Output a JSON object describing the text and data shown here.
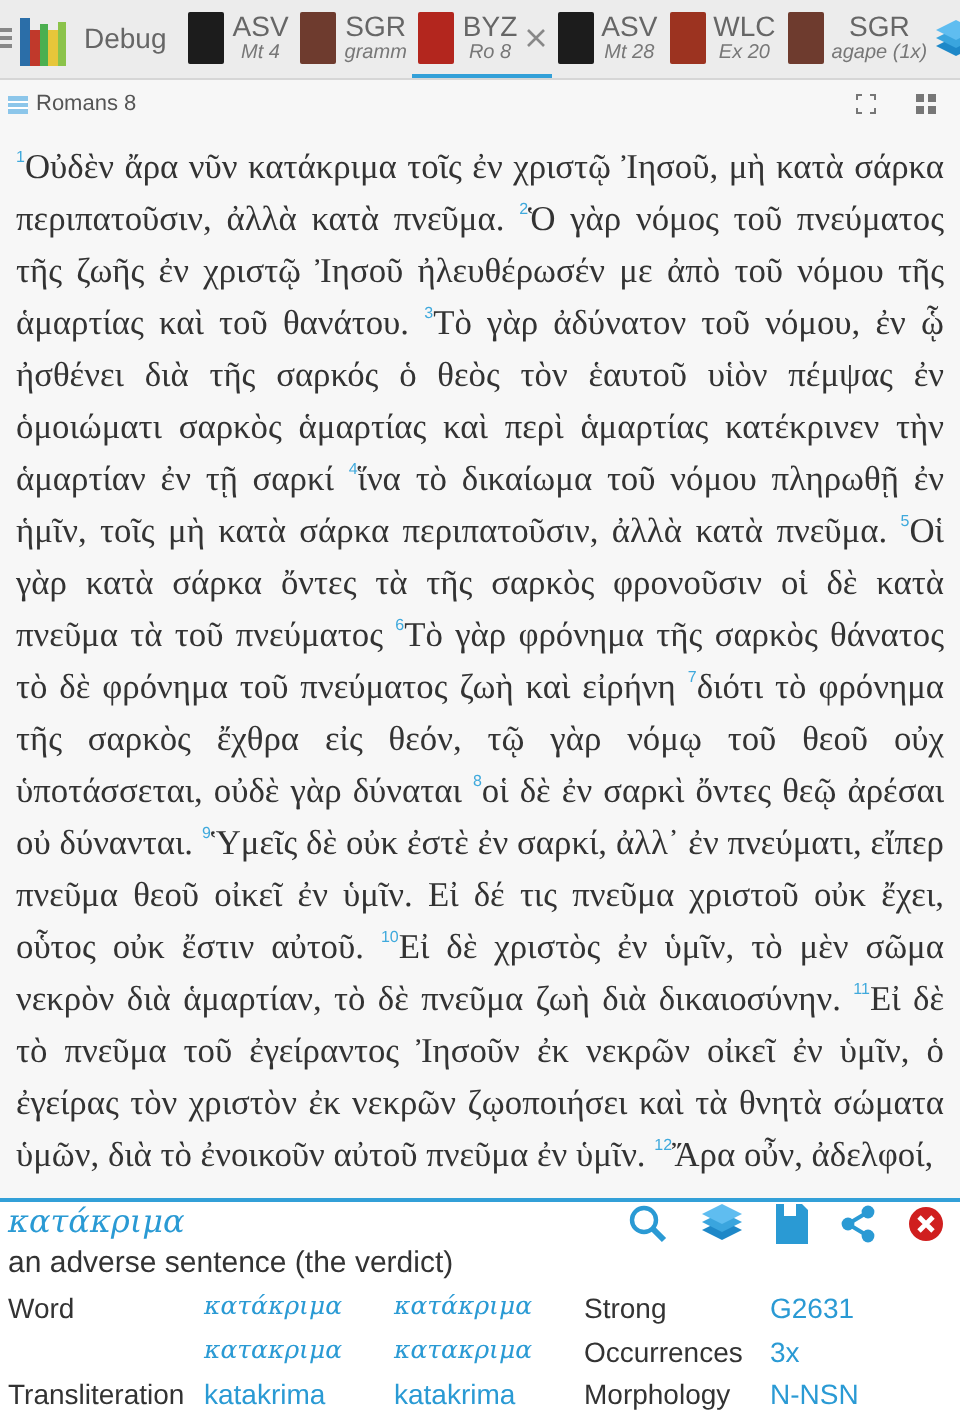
{
  "toolbar": {
    "app_label": "Debug",
    "tabs": [
      {
        "name": "ASV",
        "subtitle": "Mt 4",
        "color": "#1c1c1c",
        "selected": false,
        "closable": false
      },
      {
        "name": "SGR",
        "subtitle": "gramm",
        "color": "#6e3b2e",
        "selected": false,
        "closable": false
      },
      {
        "name": "BYZ",
        "subtitle": "Ro 8",
        "color": "#b3261e",
        "selected": true,
        "closable": true
      },
      {
        "name": "ASV",
        "subtitle": "Mt 28",
        "color": "#1c1c1c",
        "selected": false,
        "closable": false
      },
      {
        "name": "WLC",
        "subtitle": "Ex 20",
        "color": "#9c3320",
        "selected": false,
        "closable": false
      },
      {
        "name": "SGR",
        "subtitle": "agape (1x)",
        "color": "#6e3b2e",
        "selected": false,
        "closable": false
      }
    ]
  },
  "header": {
    "title": "Romans 8"
  },
  "passage": {
    "text": "$^{1}$Οὐδὲν ἄρα νῦν κατάκριμα τοῖς ἐν χριστῷ Ἰησοῦ, μὴ κατὰ σάρκα περιπατοῦσιν, ἀλλὰ κατὰ πνεῦμα. $^{2}$Ὁ γὰρ νόμος τοῦ πνεύματος τῆς ζωῆς ἐν χριστῷ Ἰησοῦ ἠλευθέρωσέν με ἀπὸ τοῦ νόμου τῆς ἁμαρτίας καὶ τοῦ θανάτου. $^{3}$Τὸ γὰρ ἀδύνατον τοῦ νόμου, ἐν ᾧ ἠσθένει διὰ τῆς σαρκός ὁ θεὸς τὸν ἑαυτοῦ υἱὸν πέμψας ἐν ὁμοιώματι σαρκὸς ἁμαρτίας καὶ περὶ ἁμαρτίας κατέκρινεν τὴν ἁμαρτίαν ἐν τῇ σαρκί $^{4}$ἵνα τὸ δικαίωμα τοῦ νόμου πληρωθῇ ἐν ἡμῖν, τοῖς μὴ κατὰ σάρκα περιπατοῦσιν, ἀλλὰ κατὰ πνεῦμα. $^{5}$Οἱ γὰρ κατὰ σάρκα ὄντες τὰ τῆς σαρκὸς φρονοῦσιν οἱ δὲ κατὰ πνεῦμα τὰ τοῦ πνεύματος $^{6}$Τὸ γὰρ φρόνημα τῆς σαρκὸς θάνατος τὸ δὲ φρόνημα τοῦ πνεύματος ζωὴ καὶ εἰρήνη $^{7}$διότι τὸ φρόνημα τῆς σαρκὸς ἔχθρα εἰς θεόν, τῷ γὰρ νόμῳ τοῦ θεοῦ οὐχ ὑποτάσσεται, οὐδὲ γὰρ δύναται $^{8}$οἱ δὲ ἐν σαρκὶ ὄντες θεῷ ἀρέσαι οὐ δύνανται. $^{9}$Ὑμεῖς δὲ οὐκ ἐστὲ ἐν σαρκί, ἀλλ᾽ ἐν πνεύματι, εἴπερ πνεῦμα θεοῦ οἰκεῖ ἐν ὑμῖν. Εἰ δέ τις πνεῦμα χριστοῦ οὐκ ἔχει, οὗτος οὐκ ἔστιν αὐτοῦ. $^{10}$Εἰ δὲ χριστὸς ἐν ὑμῖν, τὸ μὲν σῶμα νεκρὸν διὰ ἁμαρτίαν, τὸ δὲ πνεῦμα ζωὴ διὰ δικαιοσύνην. $^{11}$Εἰ δὲ τὸ πνεῦμα τοῦ ἐγείραντος Ἰησοῦν ἐκ νεκρῶν οἰκεῖ ἐν ὑμῖν, ὁ ἐγείρας τὸν χριστὸν ἐκ νεκρῶν ζῳοποιήσει καὶ τὰ θνητὰ σώματα ὑμῶν, διὰ τὸ ἐνοικοῦν αὐτοῦ πνεῦμα ἐν ὑμῖν. $^{12}$Ἄρα οὖν, ἀδελφοί,"
  },
  "word_panel": {
    "word": "κατάκριμα",
    "definition": "an adverse sentence (the verdict)",
    "rows": [
      {
        "label": "Word",
        "value_1": "κατάκριμα",
        "value_2": "κατάκριμα",
        "label_2": "Strong",
        "value_3": "G2631"
      },
      {
        "label": "",
        "value_1": "κατακριμα",
        "value_2": "κατακριμα",
        "label_2": "Occurrences",
        "value_3": "3x"
      },
      {
        "label": "Transliteration",
        "value_1": "katakrima",
        "value_2": "katakrima",
        "label_2": "Morphology",
        "value_3": "N-NSN"
      }
    ]
  }
}
